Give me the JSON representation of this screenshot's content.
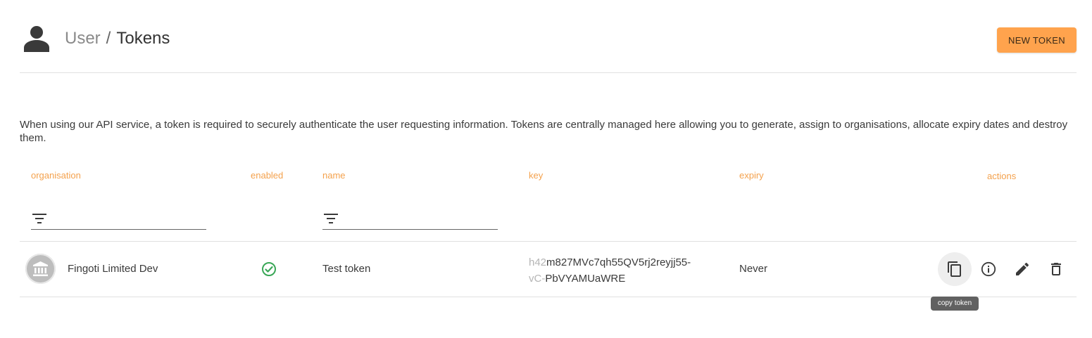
{
  "header": {
    "breadcrumb": {
      "parent": "User",
      "separator": "/",
      "current": "Tokens"
    },
    "new_token_label": "NEW TOKEN",
    "icon": "person-icon"
  },
  "description": "When using our API service, a token is required to securely authenticate the user requesting information. Tokens are centrally managed here allowing you to generate, assign to organisations, allocate expiry dates and destroy them.",
  "table": {
    "columns": {
      "organisation": "organisation",
      "enabled": "enabled",
      "name": "name",
      "key": "key",
      "expiry": "expiry",
      "actions": "actions"
    },
    "filters": {
      "organisation": {
        "icon": "filter-icon",
        "value": ""
      },
      "name": {
        "icon": "filter-icon",
        "value": ""
      }
    },
    "rows": [
      {
        "organisation": "Fingoti Limited Dev",
        "organisation_icon": "bank-icon",
        "enabled": true,
        "enabled_icon": "check-circle-icon",
        "name": "Test token",
        "key_prefix": "h42",
        "key_body": "m827MVc7qh55QV5rj2reyjj55-",
        "key_prefix2": "vC-",
        "key_body2": "PbVYAMUaWRE",
        "expiry": "Never",
        "actions": [
          "copy-icon",
          "info-icon",
          "edit-icon",
          "delete-icon"
        ]
      }
    ]
  },
  "tooltip": {
    "text": "copy token"
  },
  "colors": {
    "accent": "#ffa34d",
    "header_text": "#f4a14c",
    "enabled_green": "#3aa757",
    "tooltip_bg": "#616161"
  }
}
